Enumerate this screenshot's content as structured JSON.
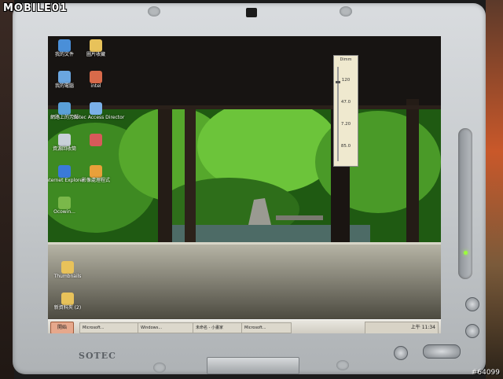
{
  "watermark": "MOBILE01",
  "photo_id": "#64099",
  "brand": "SOTEC",
  "desktop_icons": [
    {
      "label": "我的文件",
      "icon": "folder-icon",
      "color": "#4a8fd8"
    },
    {
      "label": "圖片收藏",
      "icon": "folder-icon",
      "color": "#e8c25a"
    },
    {
      "label": "我的電腦",
      "icon": "computer-icon",
      "color": "#6aa6e0"
    },
    {
      "label": "intel",
      "icon": "app-icon",
      "color": "#d86a4a"
    },
    {
      "label": "網路上的芳鄰",
      "icon": "network-icon",
      "color": "#5aa0d8"
    },
    {
      "label": "Sotec Access Director",
      "icon": "app-icon",
      "color": "#7ab0e8"
    },
    {
      "label": "資源回收筒",
      "icon": "recycle-bin-icon",
      "color": "#c8d0d8"
    },
    {
      "label": "",
      "icon": "app-icon",
      "color": "#d85a5a"
    },
    {
      "label": "Internet Explorer",
      "icon": "browser-icon",
      "color": "#3a7ad8"
    },
    {
      "label": "影像處理程式",
      "icon": "app-icon",
      "color": "#e8a03a"
    },
    {
      "label": "Ocowin...",
      "icon": "app-icon",
      "color": "#7ab84a"
    },
    {
      "label": "Thumbnails",
      "icon": "folder-icon",
      "color": "#e8c25a"
    },
    {
      "label": "新資料夾 (2)",
      "icon": "folder-icon",
      "color": "#e8c25a"
    }
  ],
  "popup": {
    "title": "Dimm",
    "values": [
      "120",
      "47.0",
      "7.20",
      "85.0"
    ]
  },
  "taskbar": {
    "start_label": "開始",
    "items": [
      "Microsoft...",
      "Windows...",
      "未命名 - 小畫家",
      "Microsoft..."
    ],
    "clock": "上午 11:34"
  }
}
